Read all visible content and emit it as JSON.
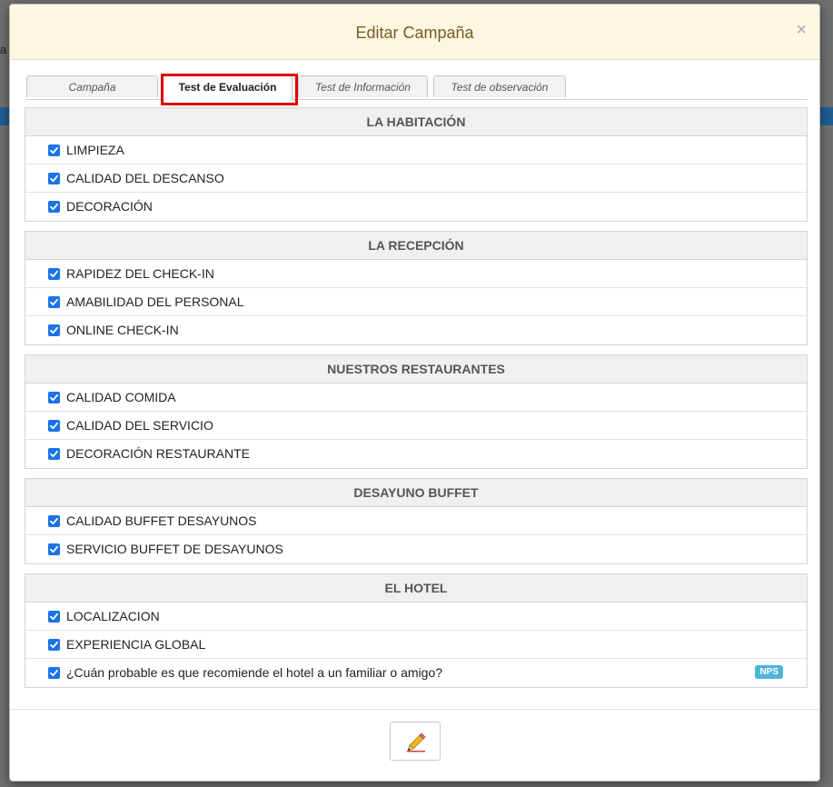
{
  "modal": {
    "title": "Editar Campaña",
    "close_label": "×"
  },
  "tabs": [
    {
      "label": "Campaña",
      "active": false
    },
    {
      "label": "Test de Evaluación",
      "active": true
    },
    {
      "label": "Test de Información",
      "active": false
    },
    {
      "label": "Test de observación",
      "active": false
    }
  ],
  "background": {
    "edge_letter": "a"
  },
  "sections": [
    {
      "title": "LA HABITACIÓN",
      "items": [
        {
          "label": "LIMPIEZA",
          "checked": true
        },
        {
          "label": "CALIDAD DEL DESCANSO",
          "checked": true
        },
        {
          "label": "DECORACIÓN",
          "checked": true
        }
      ]
    },
    {
      "title": "LA RECEPCIÓN",
      "items": [
        {
          "label": "RAPIDEZ DEL CHECK-IN",
          "checked": true
        },
        {
          "label": "AMABILIDAD DEL PERSONAL",
          "checked": true
        },
        {
          "label": "ONLINE CHECK-IN",
          "checked": true
        }
      ]
    },
    {
      "title": "NUESTROS RESTAURANTES",
      "items": [
        {
          "label": "CALIDAD COMIDA",
          "checked": true
        },
        {
          "label": "CALIDAD DEL SERVICIO",
          "checked": true
        },
        {
          "label": "DECORACIÓN RESTAURANTE",
          "checked": true
        }
      ]
    },
    {
      "title": "DESAYUNO BUFFET",
      "items": [
        {
          "label": "CALIDAD BUFFET DESAYUNOS",
          "checked": true
        },
        {
          "label": "SERVICIO BUFFET DE DESAYUNOS",
          "checked": true
        }
      ]
    },
    {
      "title": "EL HOTEL",
      "items": [
        {
          "label": "LOCALIZACION",
          "checked": true
        },
        {
          "label": "EXPERIENCIA GLOBAL",
          "checked": true
        },
        {
          "label": "¿Cuán probable es que recomiende el hotel a un familiar o amigo?",
          "checked": true,
          "badge": "NPS"
        }
      ]
    }
  ],
  "footer": {
    "edit_icon": "pencil-icon"
  },
  "colors": {
    "header_bg": "#fcf7e3",
    "title": "#7a5b24",
    "checkbox": "#1a73e8",
    "badge": "#4db3d9",
    "highlight": "#e00000"
  }
}
